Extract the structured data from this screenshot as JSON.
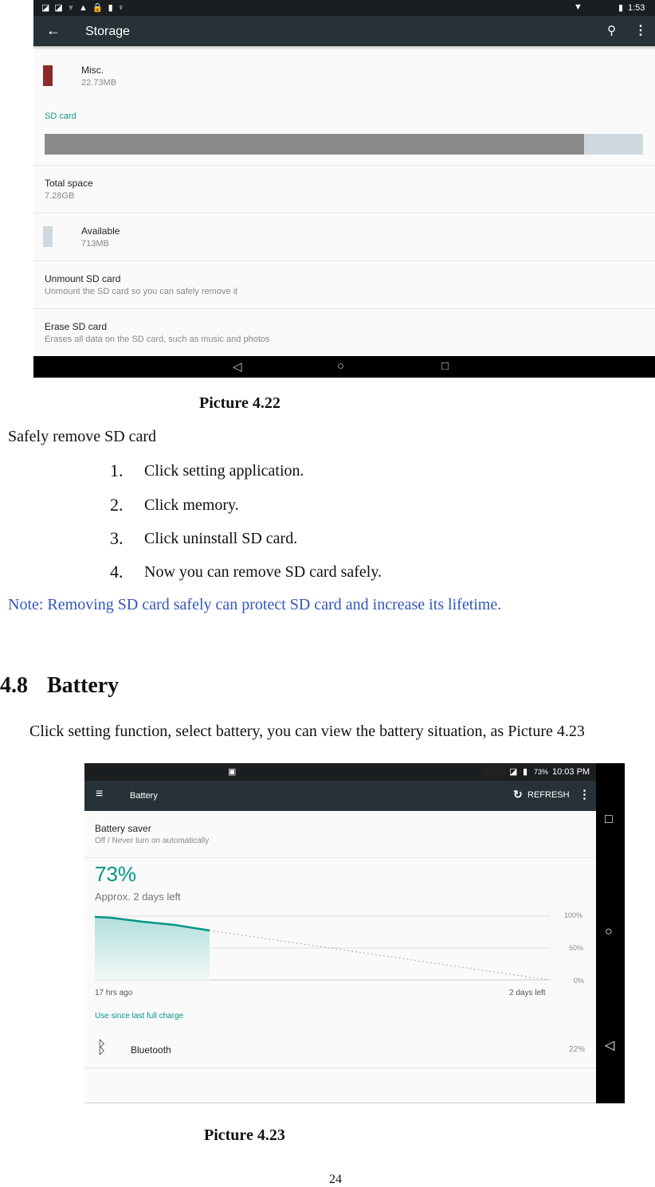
{
  "storage_screen": {
    "status_time": "1:53",
    "title": "Storage",
    "misc": {
      "label": "Misc.",
      "size": "22.73MB",
      "color": "#8b2a2a"
    },
    "sd_header": "SD card",
    "sd_used_fraction": 0.902,
    "total": {
      "label": "Total space",
      "value": "7.28GB"
    },
    "available": {
      "label": "Available",
      "value": "713MB"
    },
    "unmount": {
      "label": "Unmount SD card",
      "desc": "Unmount the SD card so you can safely remove it"
    },
    "erase": {
      "label": "Erase SD card",
      "desc": "Erases all data on the SD card, such as music and photos"
    }
  },
  "caption1": "Picture 4.22",
  "section_intro": "Safely remove SD card",
  "steps": [
    {
      "num": "1.",
      "text": "Click setting application."
    },
    {
      "num": "2.",
      "text": "Click memory."
    },
    {
      "num": "3.",
      "text": "Click uninstall SD card."
    },
    {
      "num": "4.",
      "text": "Now you can remove SD card safely."
    }
  ],
  "note": "Note: Removing SD card safely can protect SD card and increase its lifetime.",
  "heading": {
    "num": "4.8",
    "title": "Battery"
  },
  "paragraph": "Click setting function, select battery, you can view the battery situation, as Picture 4.23",
  "battery_screen": {
    "status_battery": "73%",
    "status_time": "10:03 PM",
    "title": "Battery",
    "refresh": "REFRESH",
    "saver": {
      "label": "Battery saver",
      "desc": "Off / Never turn on automatically"
    },
    "percent": "73%",
    "estimate": "Approx. 2 days left",
    "chart_labels": {
      "y100": "100%",
      "y50": "50%",
      "y0": "0%",
      "x_start": "17 hrs ago",
      "x_end": "2 days left"
    },
    "use_since": "Use since last full charge",
    "bluetooth": {
      "label": "Bluetooth",
      "value": "22%"
    },
    "accent": "#009688"
  },
  "caption2": "Picture 4.23",
  "page_number": "24"
}
